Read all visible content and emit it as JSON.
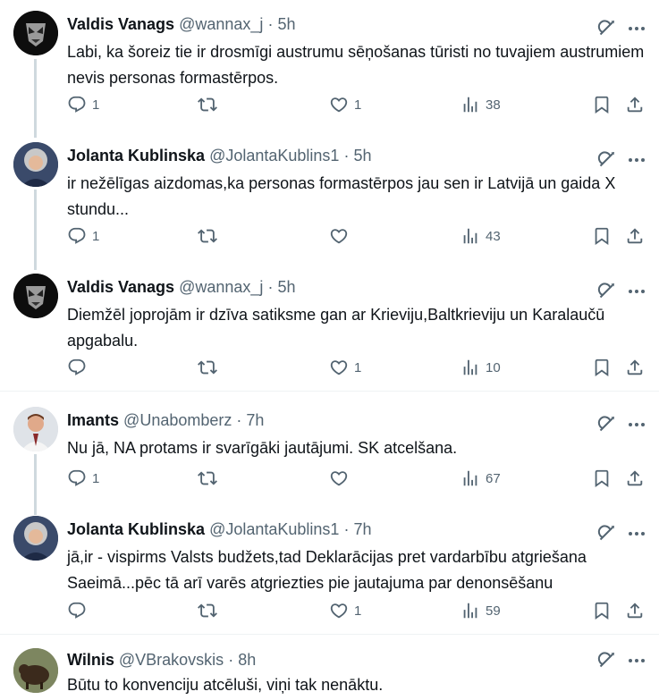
{
  "tweets": [
    {
      "name": "Valdis Vanags",
      "handle": "@wannax_j",
      "dot": "·",
      "time": "5h",
      "text": "Labi, ka šoreiz tie ir drosmīgi austrumu sēņošanas tūristi no tuvajiem austrumiem nevis personas formastērpos.",
      "replies": "1",
      "retweets": "",
      "likes": "1",
      "views": "38"
    },
    {
      "name": "Jolanta Kublinska",
      "handle": "@JolantaKublins1",
      "dot": "·",
      "time": "5h",
      "text": "ir nežēlīgas aizdomas,ka personas formastērpos jau sen ir Latvijā un gaida X stundu...",
      "replies": "1",
      "retweets": "",
      "likes": "",
      "views": "43"
    },
    {
      "name": "Valdis Vanags",
      "handle": "@wannax_j",
      "dot": "·",
      "time": "5h",
      "text": "Diemžēl joprojām ir dzīva satiksme gan ar Krieviju,Baltkrieviju un Karalaučū apgabalu.",
      "replies": "",
      "retweets": "",
      "likes": "1",
      "views": "10"
    },
    {
      "name": "Imants",
      "handle": "@Unabomberz",
      "dot": "·",
      "time": "7h",
      "text": "Nu jā, NA protams ir svarīgāki jautājumi. SK atcelšana.",
      "replies": "1",
      "retweets": "",
      "likes": "",
      "views": "67"
    },
    {
      "name": "Jolanta Kublinska",
      "handle": "@JolantaKublins1",
      "dot": "·",
      "time": "7h",
      "text": "jā,ir - vispirms Valsts budžets,tad Deklarācijas pret vardarbību atgriešana Saeimā...pēc tā arī varēs atgriezties pie jautajuma par denonsēšanu",
      "replies": "",
      "retweets": "",
      "likes": "1",
      "views": "59"
    },
    {
      "name": "Wilnis",
      "handle": "@VBrakovskis",
      "dot": "·",
      "time": "8h",
      "text": "Būtu to konvenciju atcēluši, viņi tak nenāktu.",
      "replies": "",
      "retweets": "",
      "likes": "",
      "views": ""
    }
  ],
  "icons": {
    "reply": "reply-icon",
    "retweet": "retweet-icon",
    "like": "heart-icon",
    "views": "views-icon",
    "bookmark": "bookmark-icon",
    "share": "share-icon",
    "grok": "grok-icon",
    "more": "more-icon"
  },
  "colors": {
    "text": "#0f1419",
    "secondary": "#536471",
    "thread_line": "#cfd9de",
    "divider": "#eff3f4"
  }
}
